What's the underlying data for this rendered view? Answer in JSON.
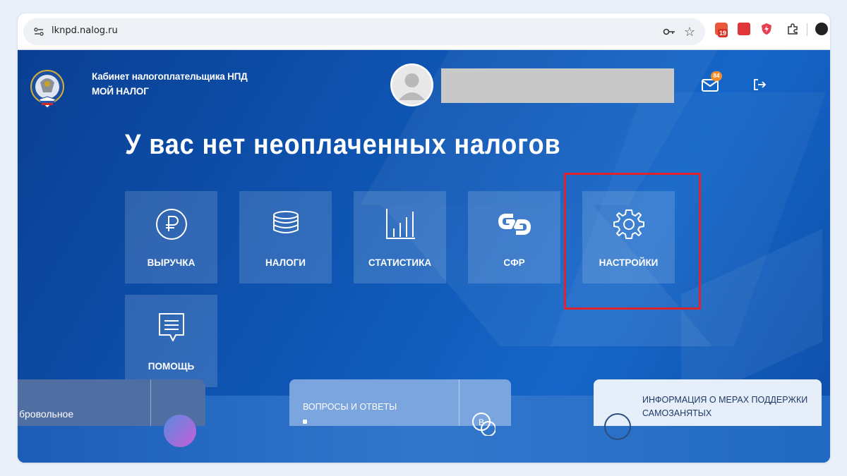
{
  "browser": {
    "url": "lknpd.nalog.ru",
    "extension_badge": "19"
  },
  "header": {
    "brand_line1": "Кабинет налогоплательщика НПД",
    "brand_line2": "МОЙ НАЛОГ",
    "mail_badge": "84"
  },
  "main": {
    "headline": "У вас нет неоплаченных налогов",
    "tiles": [
      {
        "label": "ВЫРУЧКА",
        "icon": "ruble-icon"
      },
      {
        "label": "НАЛОГИ",
        "icon": "coins-stack-icon"
      },
      {
        "label": "СТАТИСТИКА",
        "icon": "bar-chart-icon"
      },
      {
        "label": "СФР",
        "icon": "sfr-logo-icon"
      },
      {
        "label": "НАСТРОЙКИ",
        "icon": "gear-icon"
      },
      {
        "label": "ПОМОЩЬ",
        "icon": "chat-icon"
      }
    ]
  },
  "bottom": {
    "left_card_text": "бровольное",
    "mid_card_title": "ВОПРОСЫ И ОТВЕТЫ",
    "right_card_text": "ИНФОРМАЦИЯ О МЕРАХ ПОДДЕРЖКИ САМОЗАНЯТЫХ"
  },
  "colors": {
    "page_blue": "#0f57b5",
    "highlight": "#e0232b",
    "badge": "#f28c28"
  }
}
